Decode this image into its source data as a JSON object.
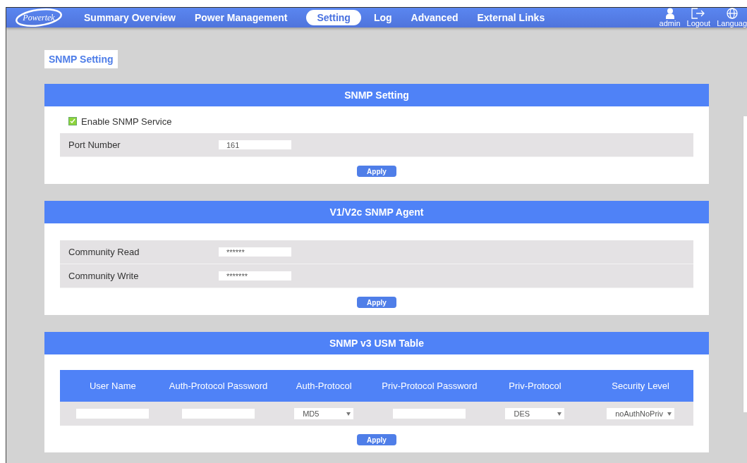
{
  "nav": {
    "logo": "Powertek",
    "items": [
      {
        "label": "Summary Overview",
        "selected": false
      },
      {
        "label": "Power Management",
        "selected": false
      },
      {
        "label": "Setting",
        "selected": true
      },
      {
        "label": "Log",
        "selected": false
      },
      {
        "label": "Advanced",
        "selected": false
      },
      {
        "label": "External Links",
        "selected": false
      }
    ],
    "user_items": [
      {
        "kind": "user",
        "label": "admin"
      },
      {
        "kind": "logout",
        "label": "Logout"
      },
      {
        "kind": "language",
        "label": "Languag"
      }
    ]
  },
  "page_title": "SNMP Setting",
  "snmp_setting": {
    "title": "SNMP Setting",
    "enable": {
      "label": "Enable SNMP Service",
      "checked": true
    },
    "rows": [
      {
        "label": "Port Number",
        "value": "161"
      }
    ],
    "apply": "Apply"
  },
  "v1v2c_agent": {
    "title": "V1/V2c SNMP Agent",
    "rows": [
      {
        "label": "Community Read",
        "value": "******"
      },
      {
        "label": "Community Write",
        "value": "*******"
      }
    ],
    "apply": "Apply"
  },
  "usm_table": {
    "title": "SNMP v3 USM Table",
    "columns": [
      "User Name",
      "Auth-Protocol Password",
      "Auth-Protocol",
      "Priv-Protocol Password",
      "Priv-Protocol",
      "Security Level"
    ],
    "row": [
      {
        "kind": "text"
      },
      {
        "kind": "text"
      },
      {
        "kind": "select",
        "value": "MD5"
      },
      {
        "kind": "text"
      },
      {
        "kind": "select",
        "value": "DES"
      },
      {
        "kind": "select",
        "value": "noAuthNoPriv"
      }
    ],
    "apply": "Apply"
  }
}
